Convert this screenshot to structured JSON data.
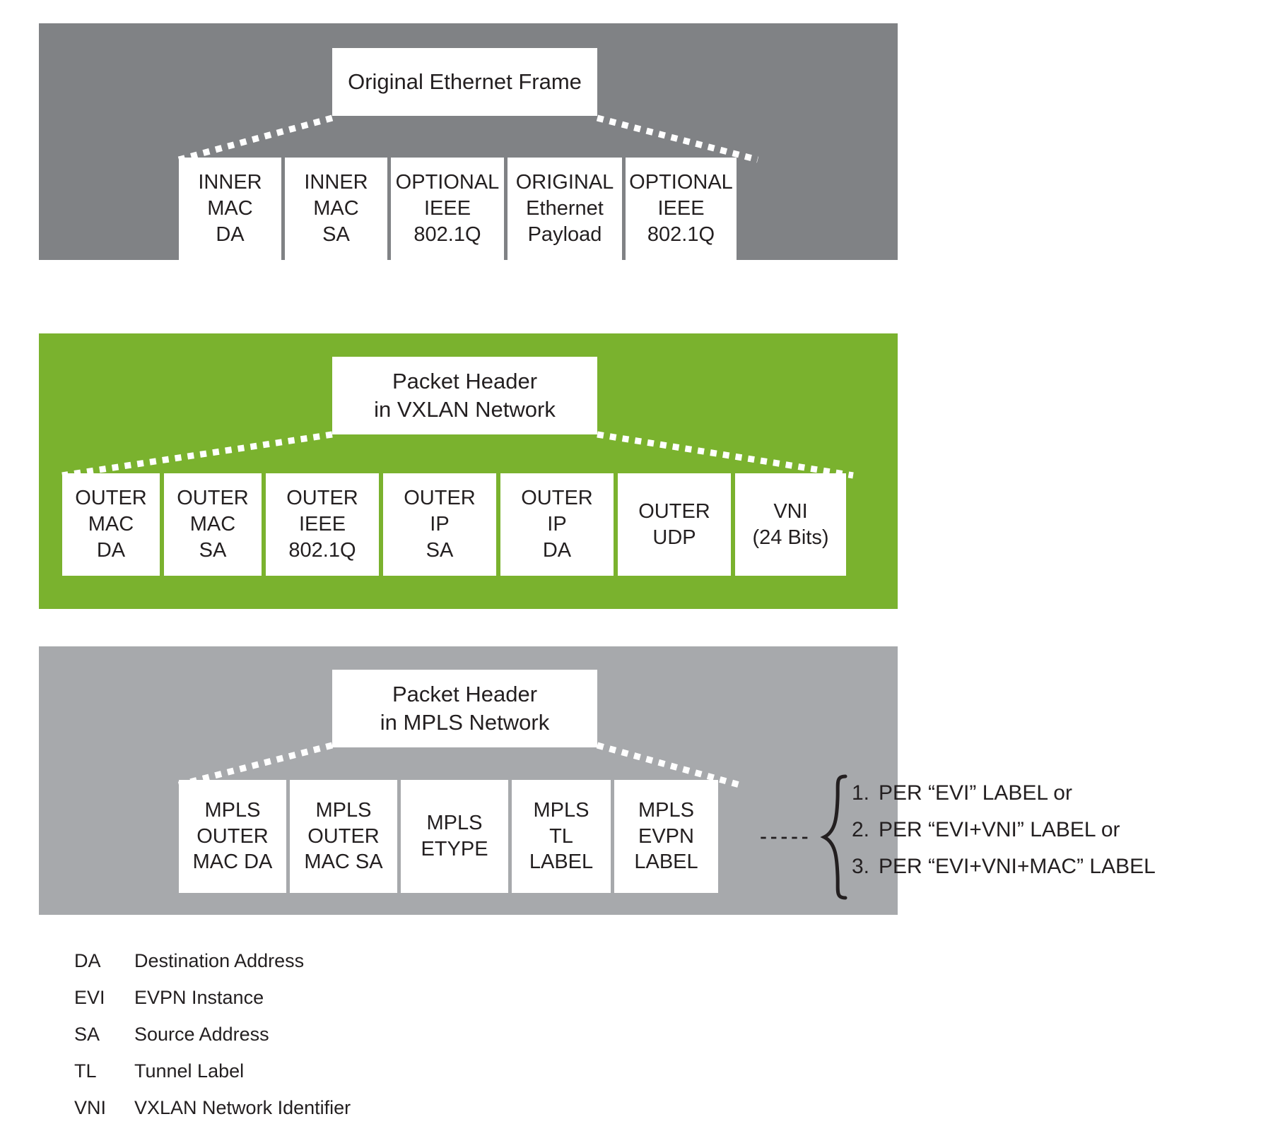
{
  "colors": {
    "band_ethernet": "#808285",
    "band_vxlan": "#7ab22e",
    "band_mpls": "#a7a9ac",
    "box_fill": "#ffffff",
    "text": "#231f20"
  },
  "sections": [
    {
      "id": "ethernet",
      "title_lines": [
        "Original Ethernet Frame"
      ],
      "fields": [
        {
          "lines": [
            "INNER",
            "MAC",
            "DA"
          ]
        },
        {
          "lines": [
            "INNER",
            "MAC",
            "SA"
          ]
        },
        {
          "lines": [
            "OPTIONAL",
            "IEEE",
            "802.1Q"
          ]
        },
        {
          "lines": [
            "ORIGINAL",
            "Ethernet",
            "Payload"
          ]
        },
        {
          "lines": [
            "OPTIONAL",
            "IEEE",
            "802.1Q"
          ]
        }
      ]
    },
    {
      "id": "vxlan",
      "title_lines": [
        "Packet Header",
        "in VXLAN Network"
      ],
      "fields": [
        {
          "lines": [
            "OUTER",
            "MAC",
            "DA"
          ]
        },
        {
          "lines": [
            "OUTER",
            "MAC",
            "SA"
          ]
        },
        {
          "lines": [
            "OUTER",
            "IEEE",
            "802.1Q"
          ]
        },
        {
          "lines": [
            "OUTER",
            "IP",
            "SA"
          ]
        },
        {
          "lines": [
            "OUTER",
            "IP",
            "DA"
          ]
        },
        {
          "lines": [
            "OUTER",
            "UDP"
          ]
        },
        {
          "lines": [
            "VNI",
            "(24 Bits)"
          ]
        }
      ]
    },
    {
      "id": "mpls",
      "title_lines": [
        "Packet Header",
        "in MPLS Network"
      ],
      "fields": [
        {
          "lines": [
            "MPLS",
            "OUTER",
            "MAC DA"
          ]
        },
        {
          "lines": [
            "MPLS",
            "OUTER",
            "MAC SA"
          ]
        },
        {
          "lines": [
            "MPLS",
            "ETYPE"
          ]
        },
        {
          "lines": [
            "MPLS",
            "TL",
            "LABEL"
          ]
        },
        {
          "lines": [
            "MPLS",
            "EVPN",
            "LABEL"
          ]
        }
      ]
    }
  ],
  "callout": {
    "items": [
      {
        "num": "1.",
        "text": "PER “EVI” LABEL or"
      },
      {
        "num": "2.",
        "text": "PER “EVI+VNI”  LABEL or"
      },
      {
        "num": "3.",
        "text": "PER “EVI+VNI+MAC” LABEL"
      }
    ]
  },
  "legend": {
    "rows": [
      {
        "abbr": "DA",
        "text": "Destination Address"
      },
      {
        "abbr": "EVI",
        "text": "EVPN Instance"
      },
      {
        "abbr": "SA",
        "text": "Source Address"
      },
      {
        "abbr": "TL",
        "text": "Tunnel Label"
      },
      {
        "abbr": "VNI",
        "text": "VXLAN Network Identifier"
      }
    ]
  }
}
